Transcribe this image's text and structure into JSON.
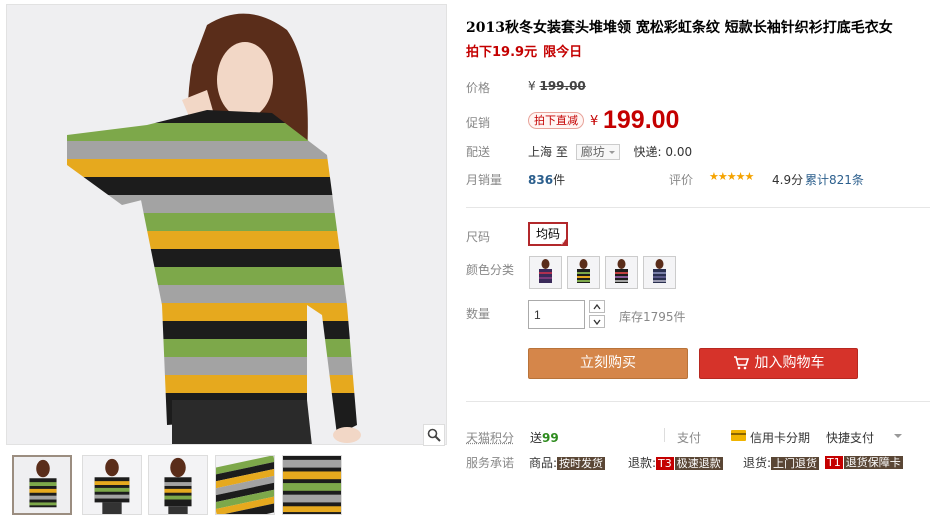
{
  "product": {
    "title": "2013秋冬女装套头堆堆领 宽松彩虹条纹 短款长袖针织衫打底毛衣女",
    "subtitle": "拍下19.9元",
    "subtitle_promo": "限今日"
  },
  "price": {
    "label": "价格",
    "currency": "¥",
    "original": "199.00"
  },
  "promo": {
    "label": "促销",
    "tag": "拍下直减",
    "currency": "¥",
    "price": "199.00"
  },
  "shipping": {
    "label": "配送",
    "from": "上海",
    "to_word": "至",
    "destination": "廊坊",
    "fee": "快递: 0.00"
  },
  "sales": {
    "label": "月销量",
    "count": "836",
    "unit": "件",
    "rating_label": "评价",
    "stars": "★★★★★",
    "score": "4.9分",
    "review_count": "累计821条"
  },
  "options": {
    "size_label": "尺码",
    "size_value": "均码",
    "size_check": "✓",
    "color_label": "颜色分类",
    "colors": [
      "color-1",
      "color-2",
      "color-3",
      "color-4"
    ]
  },
  "quantity": {
    "label": "数量",
    "value": "1",
    "stock": "库存1795件"
  },
  "actions": {
    "buy_now": "立刻购买",
    "add_to_cart": "加入购物车"
  },
  "points": {
    "label": "天猫积分",
    "prefix": "送",
    "value": "99"
  },
  "payment": {
    "label": "支付",
    "credit": "信用卡分期",
    "fast": "快捷支付"
  },
  "service": {
    "label": "服务承诺",
    "item1_text": "商品:",
    "item1_tag": "按时发货",
    "item2_text": "退款:",
    "item2_badge": "T3",
    "item2_tag": "极速退款",
    "item3_text": "退货:",
    "item3_tag": "上门退货",
    "item4_badge": "T1",
    "item4_tag": "退货保障卡"
  },
  "colors": {
    "brand_red": "#c40000",
    "buy_orange": "#d5864a",
    "cart_red": "#d6332a",
    "stripe_yellow": "#e6a91e",
    "stripe_green": "#7da84a",
    "stripe_grey": "#a3a3a3",
    "stripe_black": "#1c1c1c"
  }
}
